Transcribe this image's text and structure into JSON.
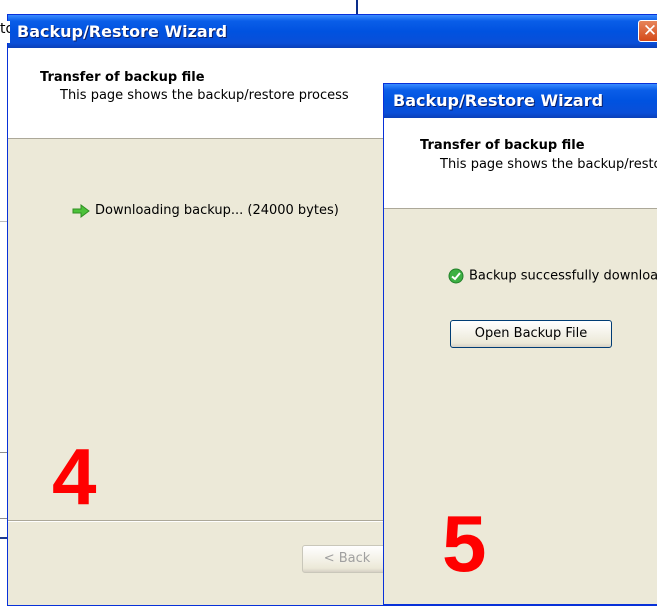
{
  "window_4": {
    "title": "Backup/Restore Wizard",
    "close_glyph": "✕",
    "header_title": "Transfer of backup file",
    "header_desc": "This page shows the backup/restore process",
    "status_icon": "green-arrow-icon",
    "status_text": "Downloading backup... (24000 bytes)",
    "back_button": "< Back",
    "step_number": "4",
    "title_fragment_left": "to"
  },
  "window_5": {
    "title": "Backup/Restore Wizard",
    "header_title": "Transfer of backup file",
    "header_desc": "This page shows the backup/restore process",
    "status_icon": "green-check-icon",
    "status_text": "Backup successfully downloaded",
    "open_button": "Open Backup File",
    "step_number": "5"
  },
  "colors": {
    "titlebar_blue": "#0052e0",
    "dialog_bg": "#ece9d8",
    "step_red": "#ff0000"
  }
}
